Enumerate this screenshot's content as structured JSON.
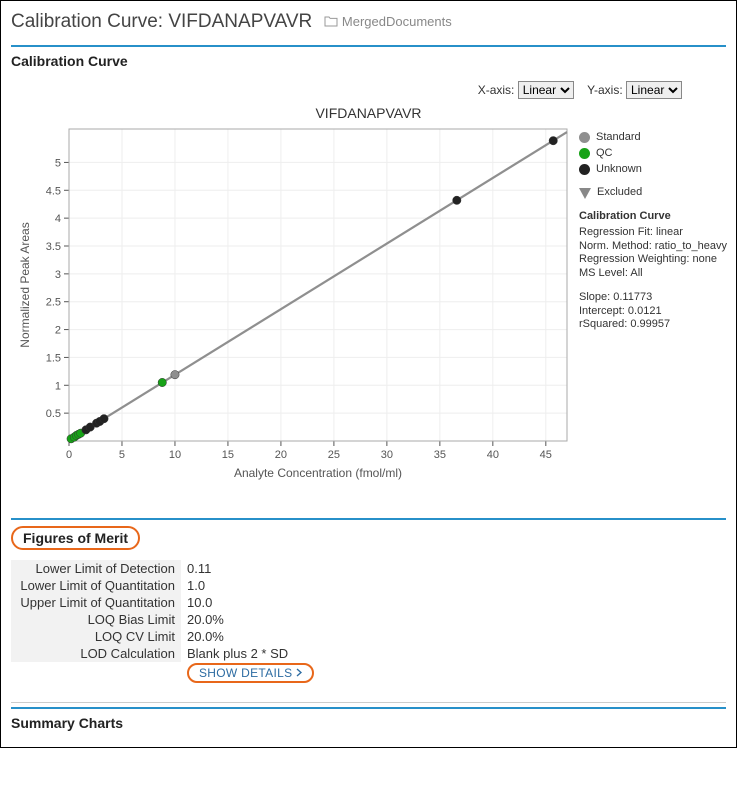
{
  "header": {
    "title": "Calibration Curve: VIFDANAPVAVR",
    "breadcrumb": "MergedDocuments"
  },
  "panel1": {
    "title": "Calibration Curve",
    "xaxis_label": "X-axis:",
    "yaxis_label": "Y-axis:",
    "xaxis_value": "Linear",
    "yaxis_value": "Linear",
    "chart_title": "VIFDANAPVAVR"
  },
  "legend": {
    "standard": "Standard",
    "qc": "QC",
    "unknown": "Unknown",
    "excluded": "Excluded",
    "calcurve_title": "Calibration Curve",
    "fit": "Regression Fit: linear",
    "norm": "Norm. Method: ratio_to_heavy",
    "weight": "Regression Weighting: none",
    "ms": "MS Level: All",
    "slope": "Slope: 0.11773",
    "intercept": "Intercept: 0.0121",
    "rsq": "rSquared: 0.99957"
  },
  "panel2": {
    "title": "Figures of Merit",
    "rows": {
      "r0_label": "Lower Limit of Detection",
      "r0_value": "0.11",
      "r1_label": "Lower Limit of Quantitation",
      "r1_value": "1.0",
      "r2_label": "Upper Limit of Quantitation",
      "r2_value": "10.0",
      "r3_label": "LOQ Bias Limit",
      "r3_value": "20.0%",
      "r4_label": "LOQ CV Limit",
      "r4_value": "20.0%",
      "r5_label": "LOD Calculation",
      "r5_value": "Blank plus 2 * SD"
    },
    "show_details": "SHOW DETAILS"
  },
  "panel3": {
    "title": "Summary Charts"
  },
  "chart_data": {
    "type": "scatter",
    "title": "VIFDANAPVAVR",
    "xlabel": "Analyte Concentration (fmol/ml)",
    "ylabel": "Normalized Peak Areas",
    "xlim": [
      0,
      47
    ],
    "ylim": [
      0,
      5.6
    ],
    "x_ticks": [
      0,
      5,
      10,
      15,
      20,
      25,
      30,
      35,
      40,
      45
    ],
    "y_ticks": [
      0.5,
      1,
      1.5,
      2,
      2.5,
      3,
      3.5,
      4,
      4.5,
      5
    ],
    "series": [
      {
        "name": "Standard",
        "color": "#8f8f8f",
        "points": [
          {
            "x": 10,
            "y": 1.19
          }
        ]
      },
      {
        "name": "QC",
        "color": "#17a217",
        "points": [
          {
            "x": 0.2,
            "y": 0.04
          },
          {
            "x": 0.5,
            "y": 0.07
          },
          {
            "x": 0.7,
            "y": 0.1
          },
          {
            "x": 0.9,
            "y": 0.12
          },
          {
            "x": 1.1,
            "y": 0.14
          },
          {
            "x": 8.8,
            "y": 1.05
          }
        ]
      },
      {
        "name": "Unknown",
        "color": "#222222",
        "points": [
          {
            "x": 1.6,
            "y": 0.2
          },
          {
            "x": 2.0,
            "y": 0.25
          },
          {
            "x": 2.6,
            "y": 0.32
          },
          {
            "x": 2.9,
            "y": 0.35
          },
          {
            "x": 3.3,
            "y": 0.4
          },
          {
            "x": 36.6,
            "y": 4.32
          },
          {
            "x": 45.7,
            "y": 5.39
          }
        ]
      }
    ],
    "fit_line": {
      "slope": 0.11773,
      "intercept": 0.0121
    }
  }
}
